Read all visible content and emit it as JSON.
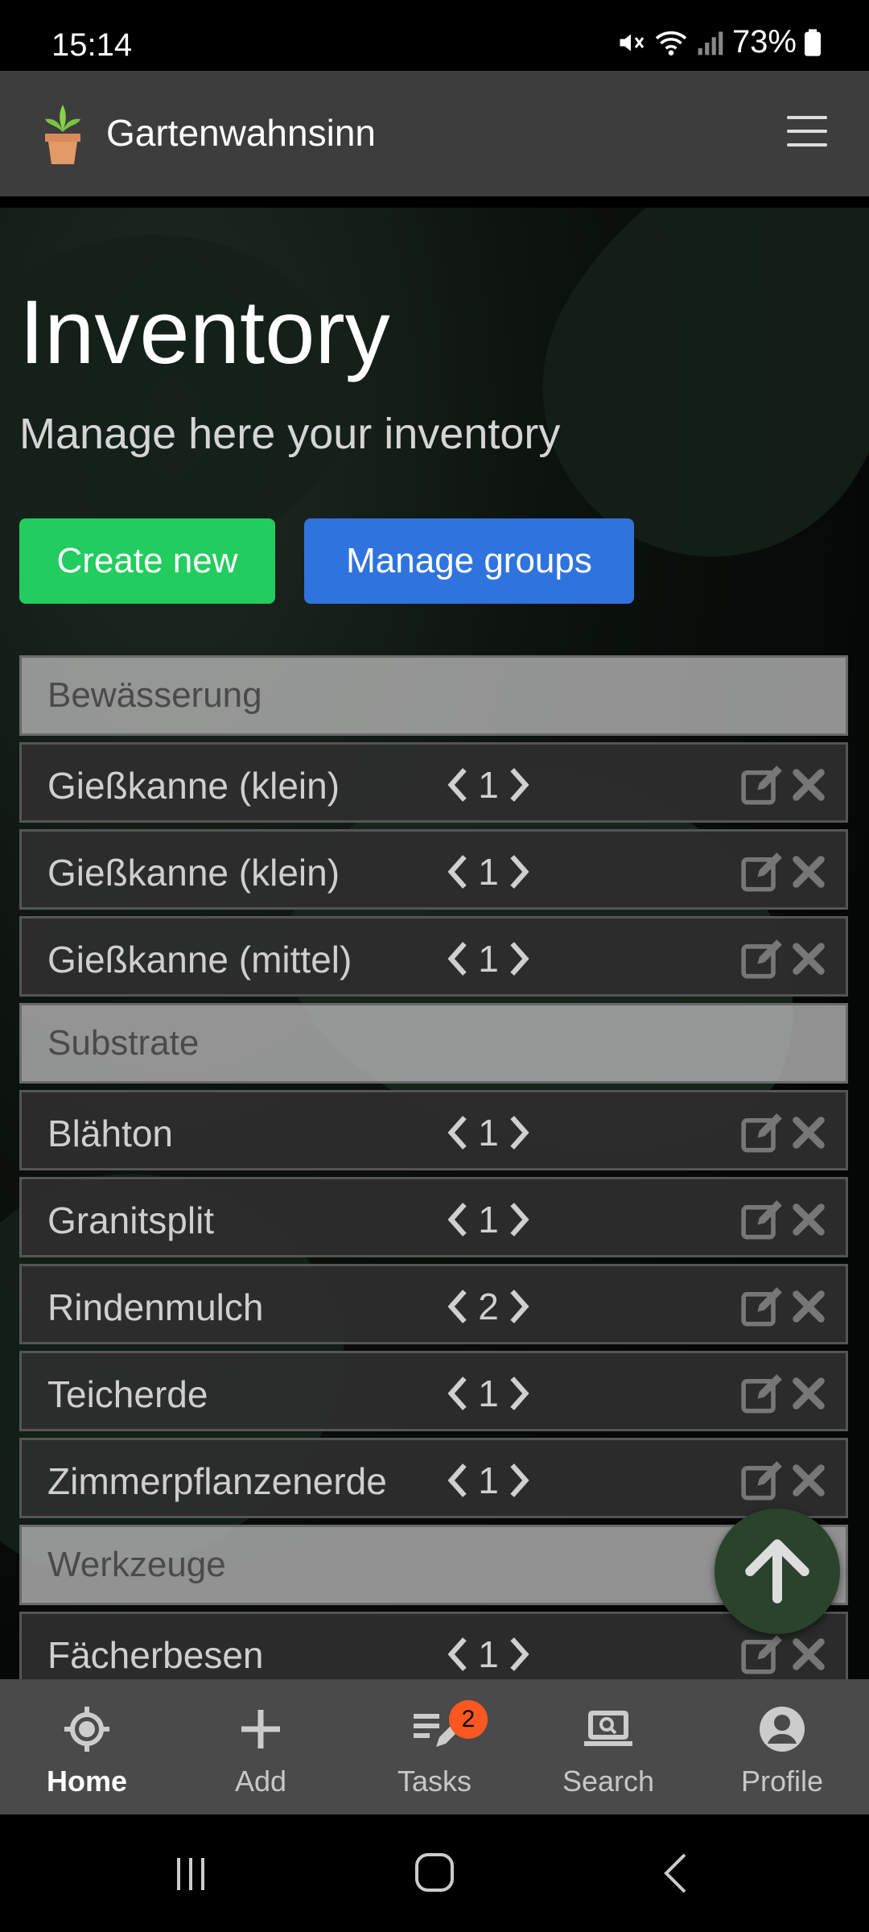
{
  "status_bar": {
    "time": "15:14",
    "battery": "73%"
  },
  "app": {
    "title": "Gartenwahnsinn"
  },
  "page": {
    "heading": "Inventory",
    "subheading": "Manage here your inventory",
    "create_button": "Create new",
    "groups_button": "Manage groups"
  },
  "inventory": {
    "groups": [
      {
        "name": "Bewässerung",
        "items": [
          {
            "name": "Gießkanne (klein)",
            "qty": "1"
          },
          {
            "name": "Gießkanne (klein)",
            "qty": "1"
          },
          {
            "name": "Gießkanne (mittel)",
            "qty": "1"
          }
        ]
      },
      {
        "name": "Substrate",
        "items": [
          {
            "name": "Blähton",
            "qty": "1"
          },
          {
            "name": "Granitsplit",
            "qty": "1"
          },
          {
            "name": "Rindenmulch",
            "qty": "2"
          },
          {
            "name": "Teicherde",
            "qty": "1"
          },
          {
            "name": "Zimmerpflanzenerde",
            "qty": "1"
          }
        ]
      },
      {
        "name": "Werkzeuge",
        "items": [
          {
            "name": "Fächerbesen",
            "qty": "1"
          }
        ]
      }
    ]
  },
  "bottom_nav": {
    "items": [
      {
        "label": "Home",
        "icon": "home-target-icon",
        "active": true
      },
      {
        "label": "Add",
        "icon": "plus-icon"
      },
      {
        "label": "Tasks",
        "icon": "tasks-icon",
        "badge": "2"
      },
      {
        "label": "Search",
        "icon": "laptop-search-icon"
      },
      {
        "label": "Profile",
        "icon": "profile-icon"
      }
    ]
  },
  "colors": {
    "create": "#22cc5e",
    "groups": "#2f74dd",
    "badge": "#ff5722",
    "fab": "#29432d"
  }
}
